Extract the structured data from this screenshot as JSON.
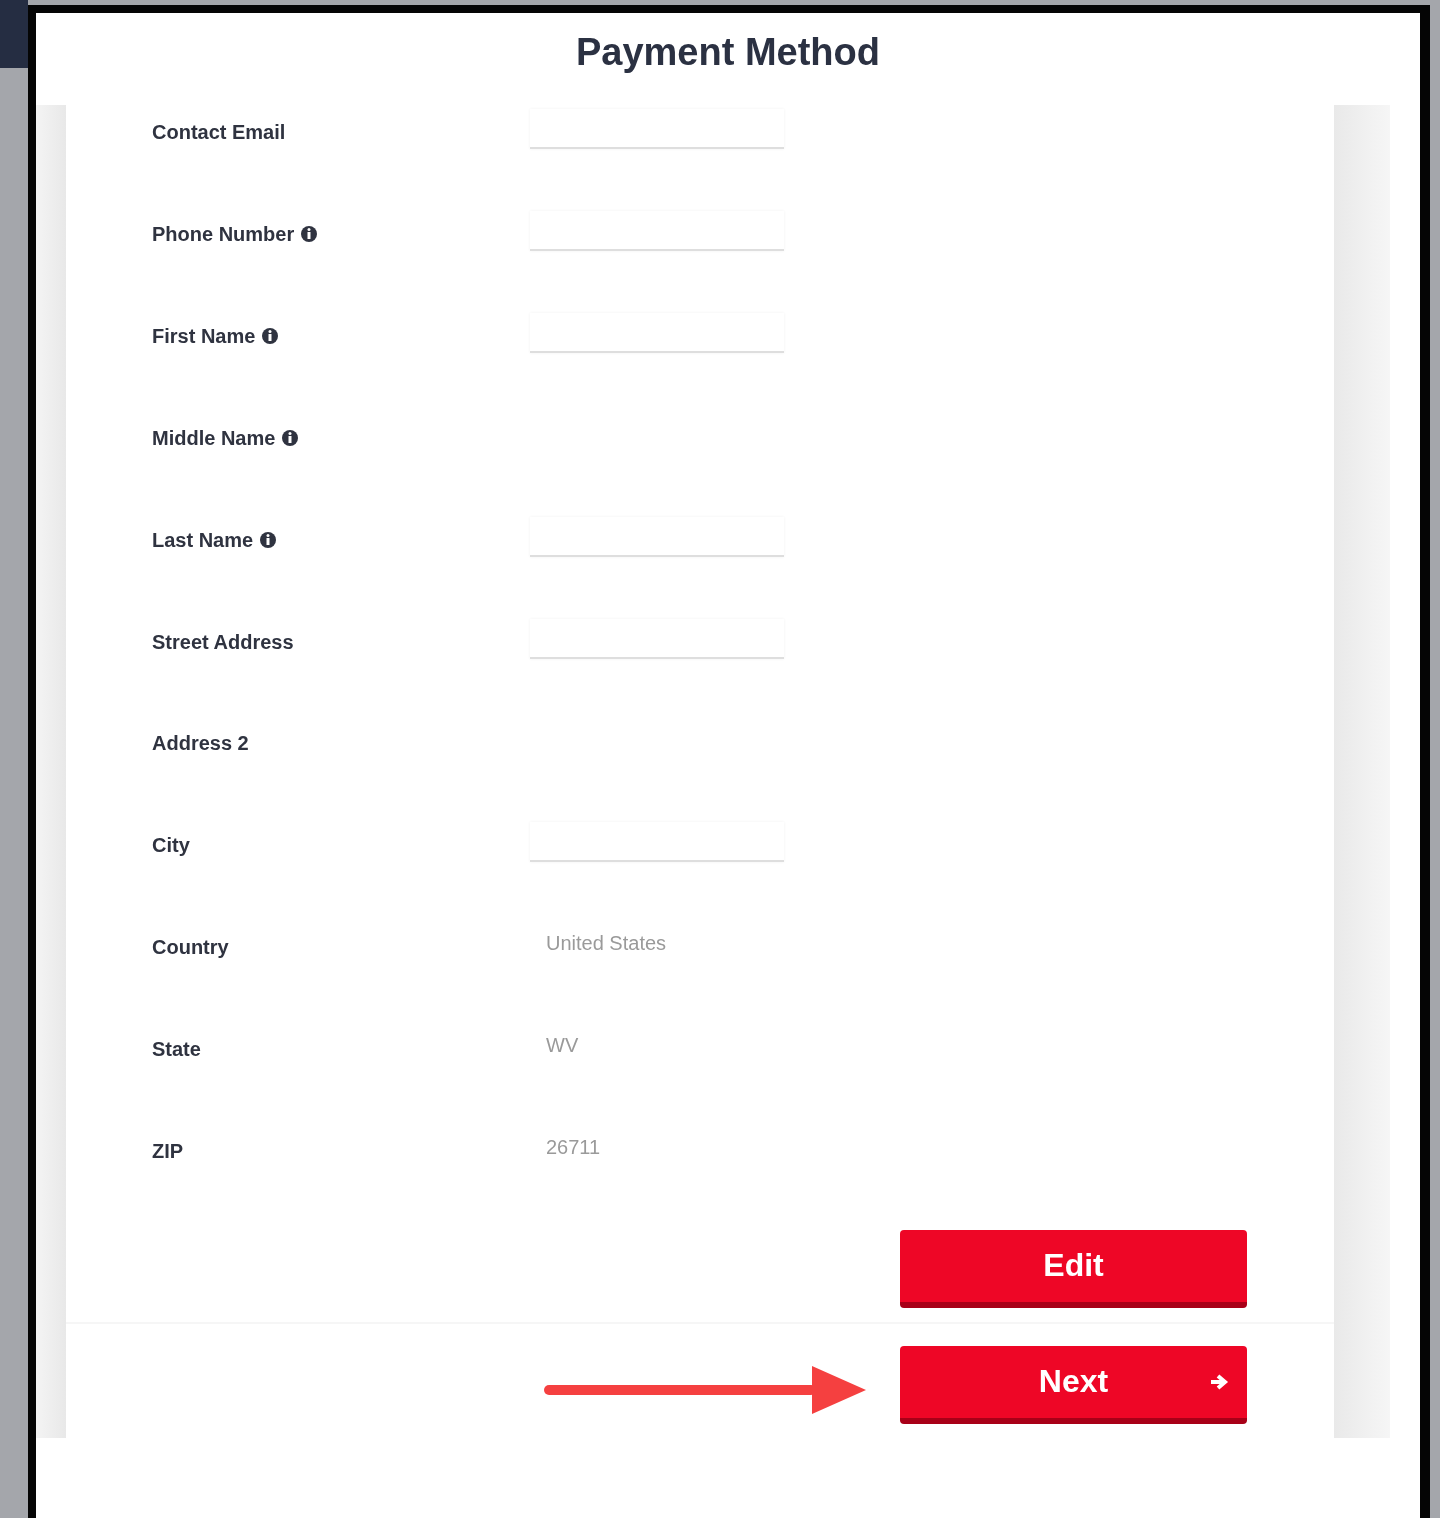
{
  "title": "Payment Method",
  "fields": [
    {
      "label": "Contact Email",
      "info": false,
      "kind": "input"
    },
    {
      "label": "Phone Number",
      "info": true,
      "kind": "input"
    },
    {
      "label": "First Name",
      "info": true,
      "kind": "input"
    },
    {
      "label": "Middle Name",
      "info": true,
      "kind": "empty"
    },
    {
      "label": "Last Name",
      "info": true,
      "kind": "input"
    },
    {
      "label": "Street Address",
      "info": false,
      "kind": "input"
    },
    {
      "label": "Address 2",
      "info": false,
      "kind": "empty"
    },
    {
      "label": "City",
      "info": false,
      "kind": "input"
    },
    {
      "label": "Country",
      "info": false,
      "kind": "value",
      "value": "United States"
    },
    {
      "label": "State",
      "info": false,
      "kind": "value",
      "value": "WV"
    },
    {
      "label": "ZIP",
      "info": false,
      "kind": "value",
      "value": "26711"
    }
  ],
  "buttons": [
    {
      "label": "Edit",
      "kind": "plain"
    },
    {
      "label": "Next",
      "kind": "forward"
    }
  ]
}
